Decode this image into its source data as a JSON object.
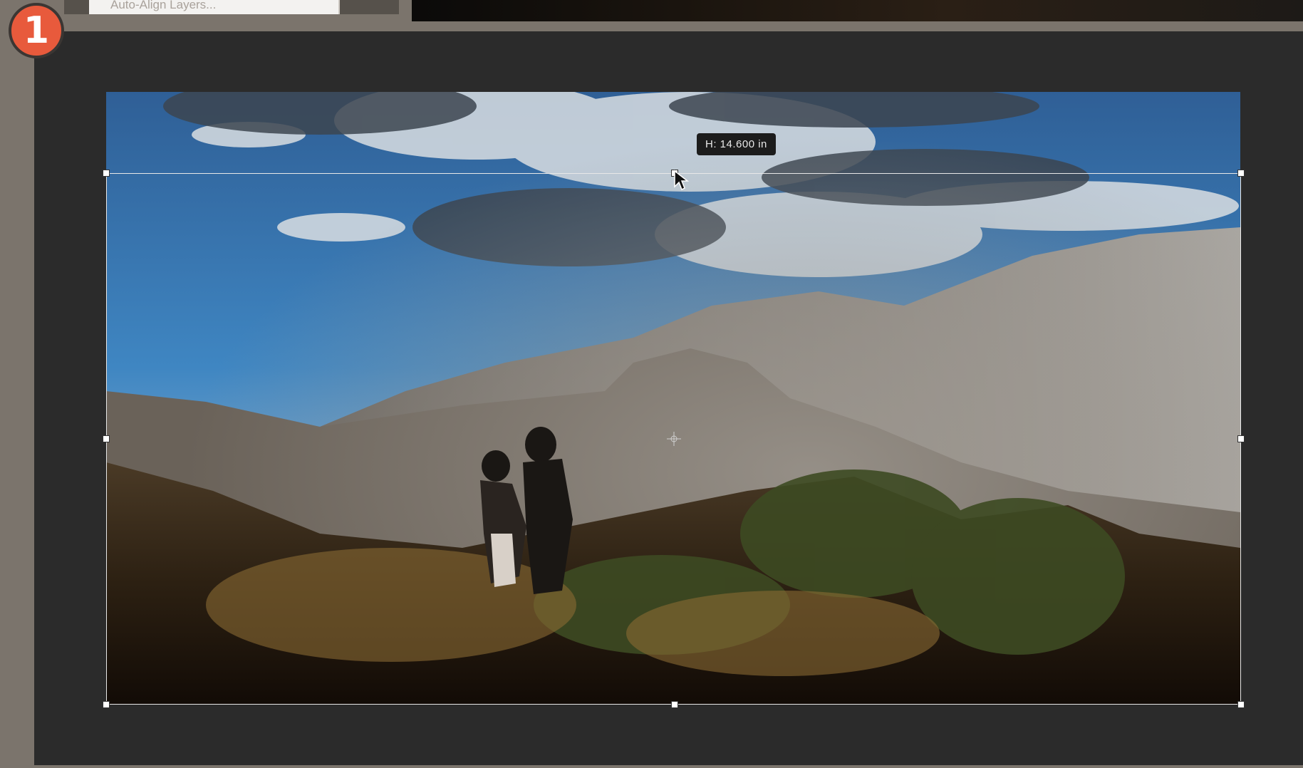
{
  "step_badge": {
    "number": "1",
    "color": "#e85a3c"
  },
  "menu": {
    "partial_item_label": "Auto-Align Layers..."
  },
  "transform": {
    "height_readout": "H: 14.600 in"
  },
  "icons": {
    "handles": "transform-handle-icon",
    "center": "reference-point-icon",
    "cursor": "arrow-cursor-icon"
  },
  "colors": {
    "canvas_bg": "#2b2b2b",
    "frame_bg": "#7b746c",
    "badge": "#e85a3c"
  }
}
